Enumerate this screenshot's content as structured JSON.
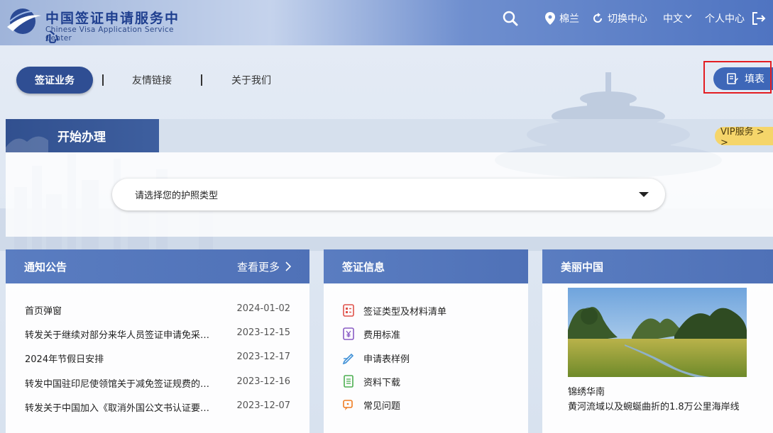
{
  "header": {
    "logo_cn": "中国签证申请服务中心",
    "logo_en": "Chinese Visa Application Service Center",
    "location": "棉兰",
    "switch_center": "切换中心",
    "language": "中文",
    "personal_center": "个人中心"
  },
  "nav": {
    "visa_business": "签证业务",
    "friendly_links": "友情链接",
    "about_us": "关于我们",
    "fill_form": "填表"
  },
  "start": {
    "title": "开始办理",
    "vip": "VIP服务 > >",
    "passport_select_placeholder": "请选择您的护照类型"
  },
  "notice": {
    "title": "通知公告",
    "more": "查看更多",
    "items": [
      {
        "title": "首页弹窗",
        "date": "2024-01-02"
      },
      {
        "title": "转发关于继续对部分来华人员签证申请免采…",
        "date": "2023-12-15"
      },
      {
        "title": "2024年节假日安排",
        "date": "2023-12-17"
      },
      {
        "title": "转发中国驻印尼使领馆关于减免签证规费的…",
        "date": "2023-12-16"
      },
      {
        "title": "转发关于中国加入《取消外国公文书认证要…",
        "date": "2023-12-07"
      }
    ]
  },
  "visa_info": {
    "title": "签证信息",
    "items": [
      {
        "label": "签证类型及材料清单",
        "icon": "checklist-icon",
        "color": "#e0524a"
      },
      {
        "label": "费用标准",
        "icon": "yuan-icon",
        "color": "#8a5cc4"
      },
      {
        "label": "申请表样例",
        "icon": "pen-icon",
        "color": "#3d8fd6"
      },
      {
        "label": "资料下载",
        "icon": "document-icon",
        "color": "#4caf50"
      },
      {
        "label": "常见问题",
        "icon": "chat-icon",
        "color": "#ef7d22"
      }
    ]
  },
  "beautiful_china": {
    "title": "美丽中国",
    "caption": "锦绣华南",
    "description": "黄河流域以及蜿蜒曲折的1.8万公里海岸线"
  },
  "colors": {
    "primary": "#2f4e93",
    "header_bar": "#5a7dc1",
    "vip": "#f5d56a",
    "highlight": "#e31d22"
  }
}
